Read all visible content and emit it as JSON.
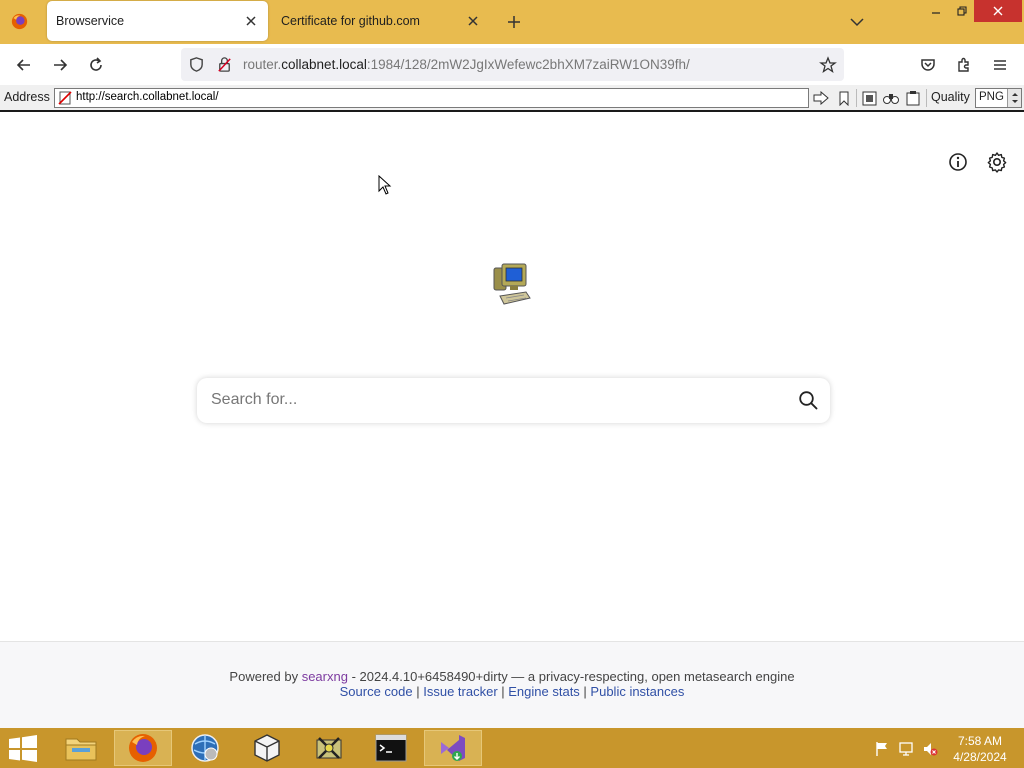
{
  "browser": {
    "tabs": [
      {
        "label": "Browservice",
        "active": true
      },
      {
        "label": "Certificate for github.com",
        "active": false
      }
    ],
    "url_prefix": "router.",
    "url_host": "collabnet.local",
    "url_rest": ":1984/128/2mW2JgIxWefewc2bhXM7zaiRW1ON39fh/"
  },
  "browservice": {
    "address_label": "Address",
    "address_value": "http://search.collabnet.local/",
    "quality_label": "Quality",
    "quality_value": "PNG"
  },
  "page": {
    "search_placeholder": "Search for...",
    "footer": {
      "powered_by": "Powered by",
      "brand": "searxng",
      "version_text": " - 2024.4.10+6458490+dirty — a privacy-respecting, open metasearch engine",
      "links": [
        "Source code",
        "Issue tracker",
        "Engine stats",
        "Public instances"
      ],
      "separator": " | "
    }
  },
  "taskbar": {
    "time": "7:58 AM",
    "date": "4/28/2024"
  },
  "colors": {
    "chrome_accent": "#e8bb4f",
    "taskbar": "#c8962c",
    "link": "#3050a6",
    "brand_link": "#7d3ba0"
  }
}
